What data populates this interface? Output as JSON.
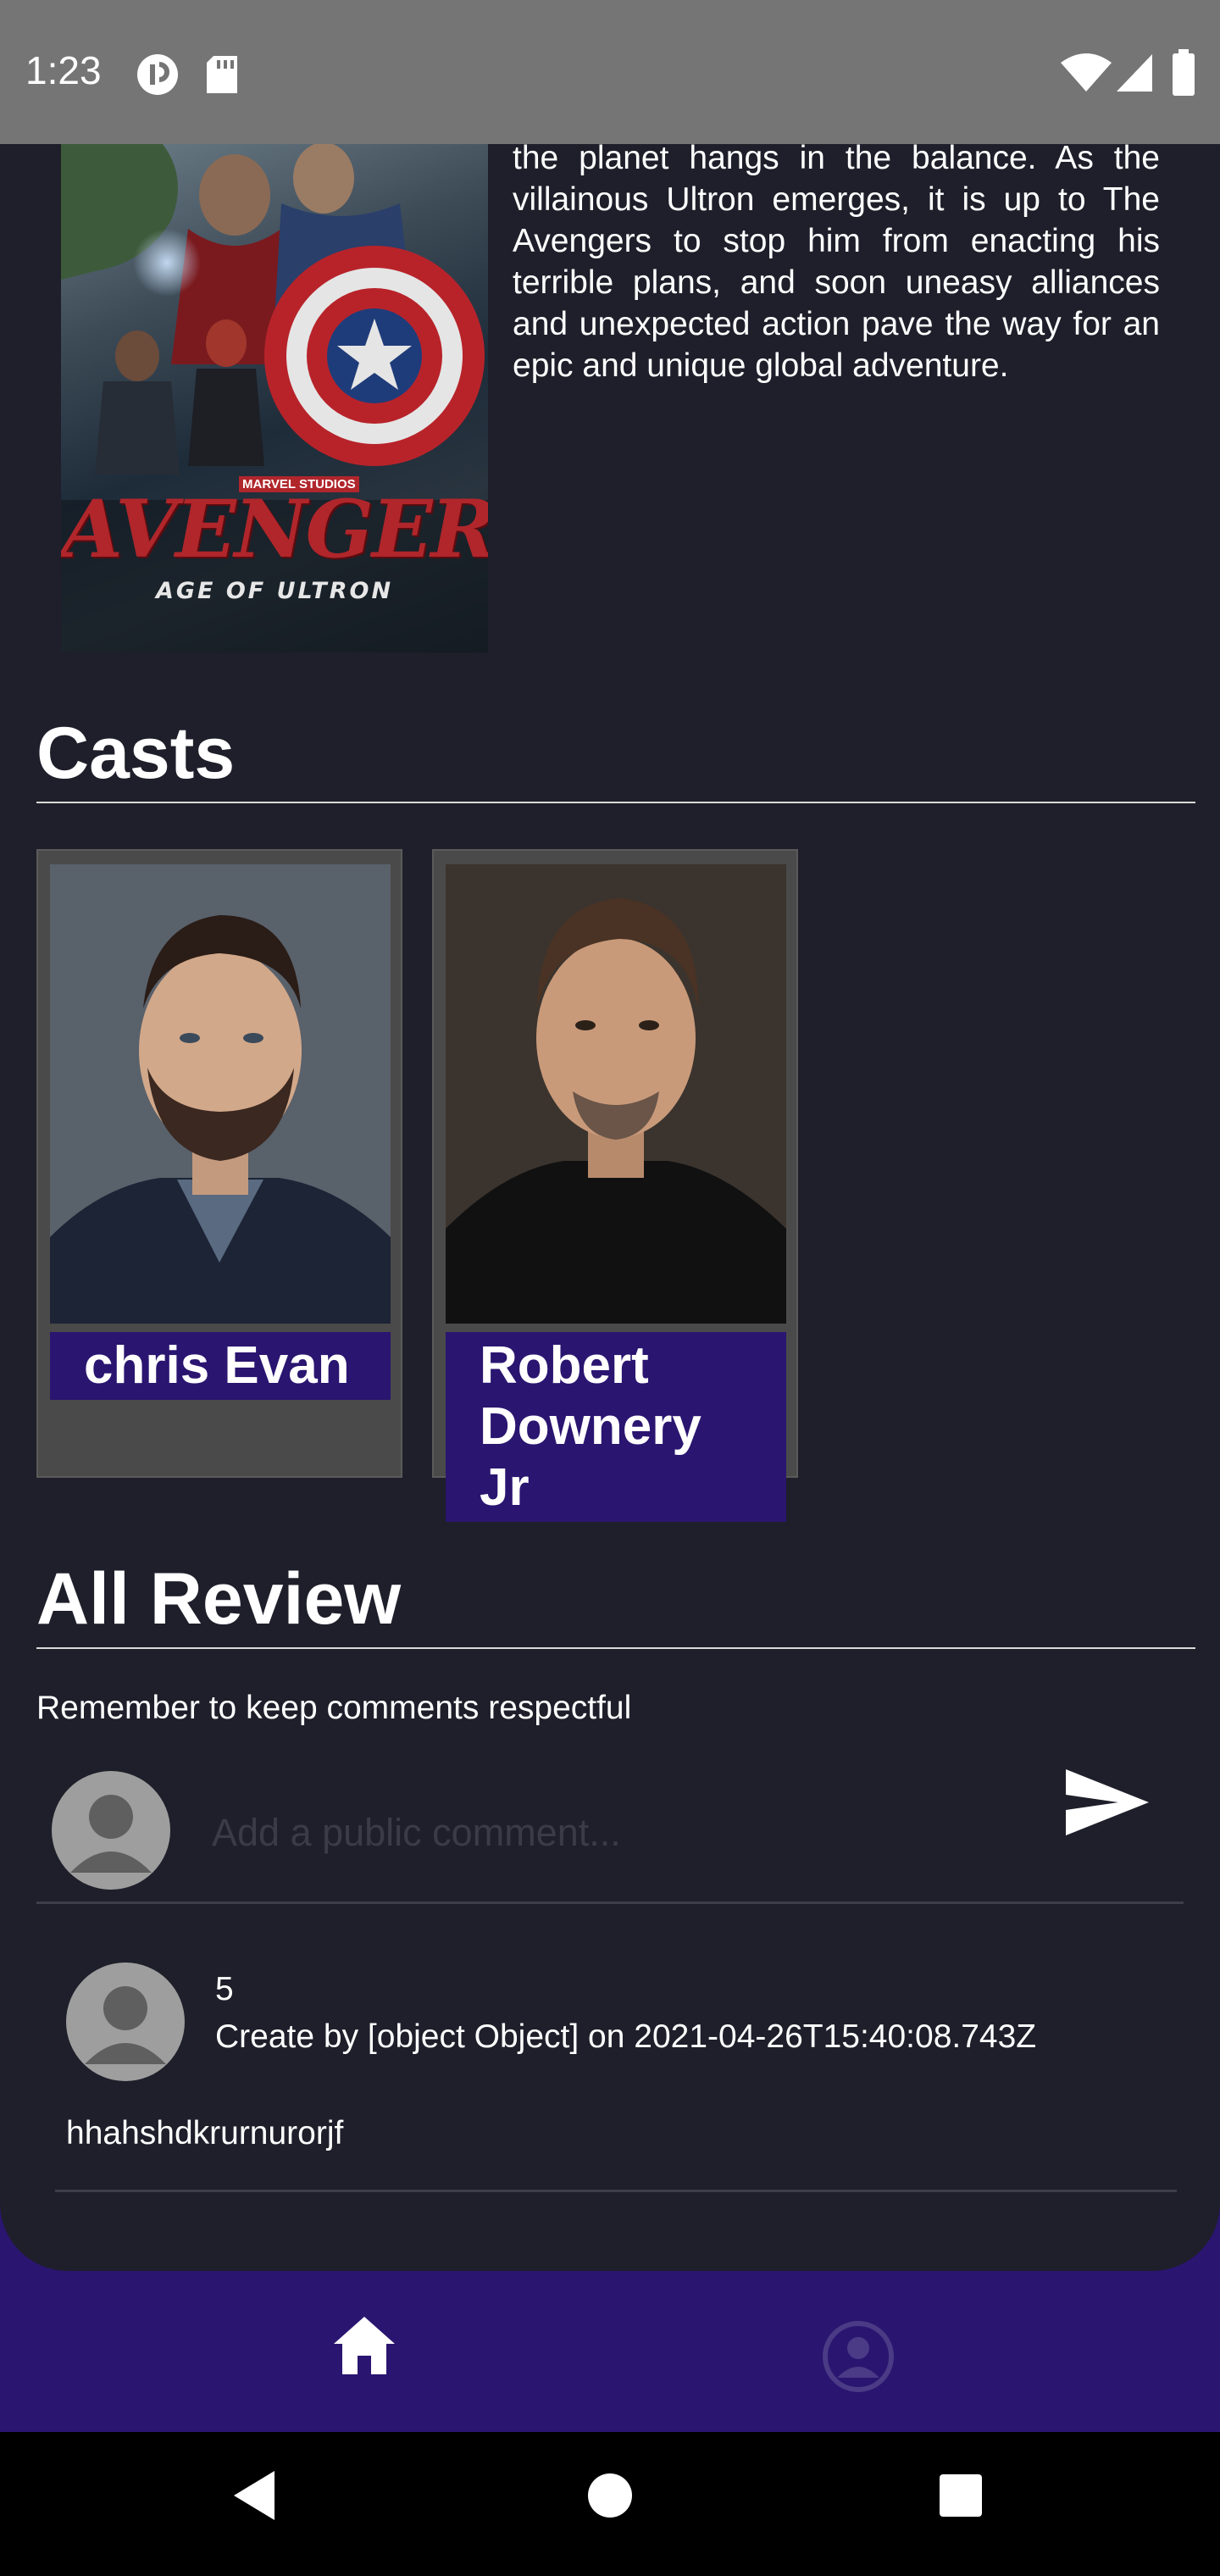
{
  "status_bar": {
    "time": "1:23"
  },
  "movie": {
    "poster_studio": "MARVEL STUDIOS",
    "poster_title": "AVENGERS",
    "poster_subtitle": "AGE OF ULTRON",
    "overview": "the planet hangs in the balance. As the villainous Ultron emerges, it is up to The Avengers to stop him from enacting his terrible plans, and soon uneasy alliances and unexpected action pave the way for an epic and unique global adventure."
  },
  "casts": {
    "title": "Casts",
    "items": [
      {
        "name": "chris Evan"
      },
      {
        "name": "Robert Downery Jr"
      }
    ]
  },
  "reviews": {
    "title": "All Review",
    "note": "Remember to keep comments respectful",
    "comment_placeholder": "Add a public comment...",
    "items": [
      {
        "rating": "5",
        "meta": "Create by [object Object] on 2021-04-26T15:40:08.743Z",
        "text": "hhahshdkrurnurorjf"
      }
    ]
  },
  "colors": {
    "background": "#1e1f2a",
    "accent": "#2a1570",
    "status_bar": "#757575"
  },
  "icons": {
    "send": "send-icon",
    "home": "home-icon",
    "profile": "account-circle-icon"
  }
}
